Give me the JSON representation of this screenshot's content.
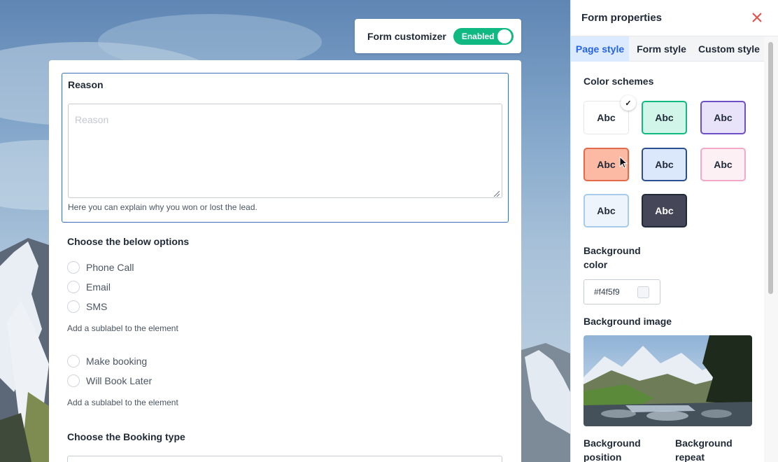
{
  "customizer": {
    "label": "Form customizer",
    "toggle_text": "Enabled"
  },
  "form": {
    "reason": {
      "title": "Reason",
      "placeholder": "Reason",
      "helper": "Here you can explain why you won or lost the lead."
    },
    "options_group": {
      "title": "Choose the below options",
      "options": [
        "Phone Call",
        "Email",
        "SMS"
      ],
      "sublabel": "Add a sublabel to the element",
      "options2": [
        "Make booking",
        "Will Book Later"
      ],
      "sublabel2": "Add a sublabel to the element"
    },
    "booking_type": {
      "title": "Choose the Booking type"
    }
  },
  "panel": {
    "title": "Form properties",
    "tabs": [
      "Page style",
      "Form style",
      "Custom style"
    ],
    "active_tab": "Page style",
    "color_schemes": {
      "title": "Color schemes",
      "swatches": [
        {
          "label": "Abc",
          "bg": "#ffffff",
          "border": "#ffffff",
          "text": "#1f2937",
          "selected": true
        },
        {
          "label": "Abc",
          "bg": "#d1f5e8",
          "border": "#10b981",
          "text": "#1f2937"
        },
        {
          "label": "Abc",
          "bg": "#e9e3fa",
          "border": "#6d4fc7",
          "text": "#1f2937"
        },
        {
          "label": "Abc",
          "bg": "#fcb9a3",
          "border": "#e36b4c",
          "text": "#1f2937"
        },
        {
          "label": "Abc",
          "bg": "#dbe8fb",
          "border": "#2b4f8f",
          "text": "#1f2937"
        },
        {
          "label": "Abc",
          "bg": "#fdf0f5",
          "border": "#f3a8c8",
          "text": "#1f2937"
        },
        {
          "label": "Abc",
          "bg": "#eef4fb",
          "border": "#a7cbe8",
          "text": "#1f2937"
        },
        {
          "label": "Abc",
          "bg": "#454758",
          "border": "#1f2937",
          "text": "#ffffff"
        }
      ]
    },
    "background_color": {
      "title_line1": "Background",
      "title_line2": "color",
      "value": "#f4f5f9"
    },
    "background_image": {
      "title": "Background image"
    },
    "background_position": {
      "title_line1": "Background",
      "title_line2": "position"
    },
    "background_repeat": {
      "title_line1": "Background",
      "title_line2": "repeat"
    }
  }
}
